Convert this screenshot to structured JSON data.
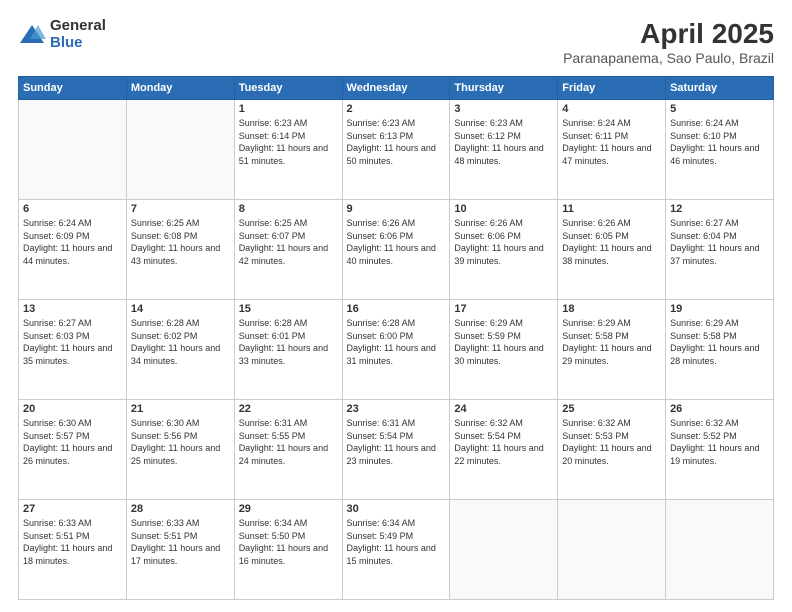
{
  "logo": {
    "general": "General",
    "blue": "Blue"
  },
  "title": "April 2025",
  "subtitle": "Paranapanema, Sao Paulo, Brazil",
  "headers": [
    "Sunday",
    "Monday",
    "Tuesday",
    "Wednesday",
    "Thursday",
    "Friday",
    "Saturday"
  ],
  "weeks": [
    [
      {
        "day": "",
        "detail": ""
      },
      {
        "day": "",
        "detail": ""
      },
      {
        "day": "1",
        "detail": "Sunrise: 6:23 AM\nSunset: 6:14 PM\nDaylight: 11 hours and 51 minutes."
      },
      {
        "day": "2",
        "detail": "Sunrise: 6:23 AM\nSunset: 6:13 PM\nDaylight: 11 hours and 50 minutes."
      },
      {
        "day": "3",
        "detail": "Sunrise: 6:23 AM\nSunset: 6:12 PM\nDaylight: 11 hours and 48 minutes."
      },
      {
        "day": "4",
        "detail": "Sunrise: 6:24 AM\nSunset: 6:11 PM\nDaylight: 11 hours and 47 minutes."
      },
      {
        "day": "5",
        "detail": "Sunrise: 6:24 AM\nSunset: 6:10 PM\nDaylight: 11 hours and 46 minutes."
      }
    ],
    [
      {
        "day": "6",
        "detail": "Sunrise: 6:24 AM\nSunset: 6:09 PM\nDaylight: 11 hours and 44 minutes."
      },
      {
        "day": "7",
        "detail": "Sunrise: 6:25 AM\nSunset: 6:08 PM\nDaylight: 11 hours and 43 minutes."
      },
      {
        "day": "8",
        "detail": "Sunrise: 6:25 AM\nSunset: 6:07 PM\nDaylight: 11 hours and 42 minutes."
      },
      {
        "day": "9",
        "detail": "Sunrise: 6:26 AM\nSunset: 6:06 PM\nDaylight: 11 hours and 40 minutes."
      },
      {
        "day": "10",
        "detail": "Sunrise: 6:26 AM\nSunset: 6:06 PM\nDaylight: 11 hours and 39 minutes."
      },
      {
        "day": "11",
        "detail": "Sunrise: 6:26 AM\nSunset: 6:05 PM\nDaylight: 11 hours and 38 minutes."
      },
      {
        "day": "12",
        "detail": "Sunrise: 6:27 AM\nSunset: 6:04 PM\nDaylight: 11 hours and 37 minutes."
      }
    ],
    [
      {
        "day": "13",
        "detail": "Sunrise: 6:27 AM\nSunset: 6:03 PM\nDaylight: 11 hours and 35 minutes."
      },
      {
        "day": "14",
        "detail": "Sunrise: 6:28 AM\nSunset: 6:02 PM\nDaylight: 11 hours and 34 minutes."
      },
      {
        "day": "15",
        "detail": "Sunrise: 6:28 AM\nSunset: 6:01 PM\nDaylight: 11 hours and 33 minutes."
      },
      {
        "day": "16",
        "detail": "Sunrise: 6:28 AM\nSunset: 6:00 PM\nDaylight: 11 hours and 31 minutes."
      },
      {
        "day": "17",
        "detail": "Sunrise: 6:29 AM\nSunset: 5:59 PM\nDaylight: 11 hours and 30 minutes."
      },
      {
        "day": "18",
        "detail": "Sunrise: 6:29 AM\nSunset: 5:58 PM\nDaylight: 11 hours and 29 minutes."
      },
      {
        "day": "19",
        "detail": "Sunrise: 6:29 AM\nSunset: 5:58 PM\nDaylight: 11 hours and 28 minutes."
      }
    ],
    [
      {
        "day": "20",
        "detail": "Sunrise: 6:30 AM\nSunset: 5:57 PM\nDaylight: 11 hours and 26 minutes."
      },
      {
        "day": "21",
        "detail": "Sunrise: 6:30 AM\nSunset: 5:56 PM\nDaylight: 11 hours and 25 minutes."
      },
      {
        "day": "22",
        "detail": "Sunrise: 6:31 AM\nSunset: 5:55 PM\nDaylight: 11 hours and 24 minutes."
      },
      {
        "day": "23",
        "detail": "Sunrise: 6:31 AM\nSunset: 5:54 PM\nDaylight: 11 hours and 23 minutes."
      },
      {
        "day": "24",
        "detail": "Sunrise: 6:32 AM\nSunset: 5:54 PM\nDaylight: 11 hours and 22 minutes."
      },
      {
        "day": "25",
        "detail": "Sunrise: 6:32 AM\nSunset: 5:53 PM\nDaylight: 11 hours and 20 minutes."
      },
      {
        "day": "26",
        "detail": "Sunrise: 6:32 AM\nSunset: 5:52 PM\nDaylight: 11 hours and 19 minutes."
      }
    ],
    [
      {
        "day": "27",
        "detail": "Sunrise: 6:33 AM\nSunset: 5:51 PM\nDaylight: 11 hours and 18 minutes."
      },
      {
        "day": "28",
        "detail": "Sunrise: 6:33 AM\nSunset: 5:51 PM\nDaylight: 11 hours and 17 minutes."
      },
      {
        "day": "29",
        "detail": "Sunrise: 6:34 AM\nSunset: 5:50 PM\nDaylight: 11 hours and 16 minutes."
      },
      {
        "day": "30",
        "detail": "Sunrise: 6:34 AM\nSunset: 5:49 PM\nDaylight: 11 hours and 15 minutes."
      },
      {
        "day": "",
        "detail": ""
      },
      {
        "day": "",
        "detail": ""
      },
      {
        "day": "",
        "detail": ""
      }
    ]
  ]
}
